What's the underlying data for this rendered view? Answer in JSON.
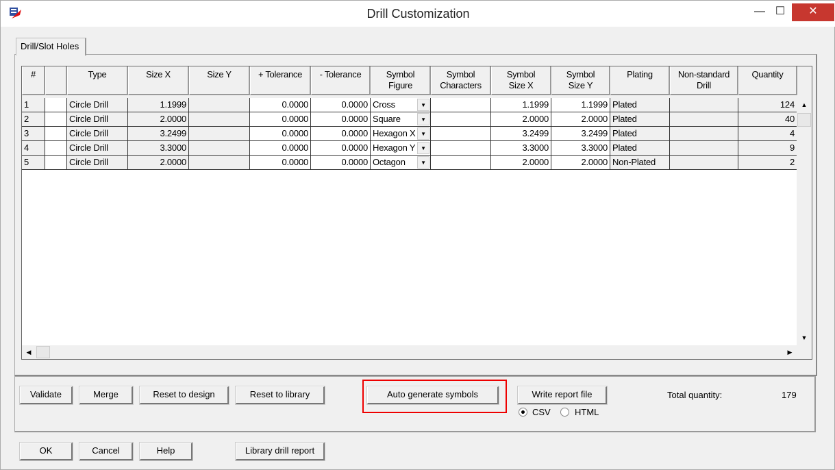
{
  "window": {
    "title": "Drill Customization",
    "minimize": "—",
    "maximize": "☐",
    "close": "✕"
  },
  "tabs": [
    {
      "label": "Drill/Slot Holes",
      "active": true
    }
  ],
  "table": {
    "columns": [
      "#",
      "",
      "Type",
      "Size X",
      "Size Y",
      "+ Tolerance",
      "- Tolerance",
      "Symbol\nFigure",
      "Symbol\nCharacters",
      "Symbol\nSize X",
      "Symbol\nSize Y",
      "Plating",
      "Non-standard\nDrill",
      "Quantity"
    ],
    "rows": [
      [
        "1",
        "",
        "Circle Drill",
        "1.1999",
        "",
        "0.0000",
        "0.0000",
        "Cross",
        "",
        "1.1999",
        "1.1999",
        "Plated",
        "",
        "124"
      ],
      [
        "2",
        "",
        "Circle Drill",
        "2.0000",
        "",
        "0.0000",
        "0.0000",
        "Square",
        "",
        "2.0000",
        "2.0000",
        "Plated",
        "",
        "40"
      ],
      [
        "3",
        "",
        "Circle Drill",
        "3.2499",
        "",
        "0.0000",
        "0.0000",
        "Hexagon X",
        "",
        "3.2499",
        "3.2499",
        "Plated",
        "",
        "4"
      ],
      [
        "4",
        "",
        "Circle Drill",
        "3.3000",
        "",
        "0.0000",
        "0.0000",
        "Hexagon Y",
        "",
        "3.3000",
        "3.3000",
        "Plated",
        "",
        "9"
      ],
      [
        "5",
        "",
        "Circle Drill",
        "2.0000",
        "",
        "0.0000",
        "0.0000",
        "Octagon",
        "",
        "2.0000",
        "2.0000",
        "Non-Plated",
        "",
        "2"
      ]
    ]
  },
  "actions": {
    "validate": "Validate",
    "merge": "Merge",
    "reset_design": "Reset to design",
    "reset_library": "Reset to library",
    "auto_generate": "Auto generate symbols",
    "write_report": "Write report file",
    "csv": "CSV",
    "html": "HTML",
    "report_format_selected": "CSV",
    "total_label": "Total quantity:",
    "total_value": "179"
  },
  "footer": {
    "ok": "OK",
    "cancel": "Cancel",
    "help": "Help",
    "library_report": "Library drill report"
  },
  "colors": {
    "highlight": "#e00000",
    "close_button": "#c7372f"
  }
}
